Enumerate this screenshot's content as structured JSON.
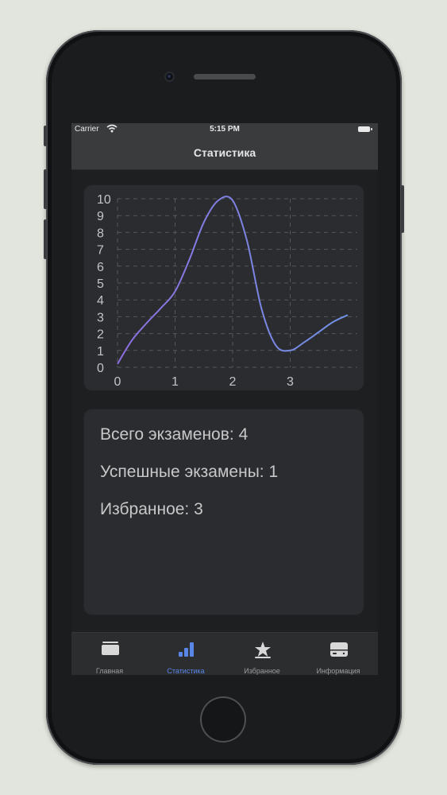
{
  "status_bar": {
    "carrier": "Carrier",
    "time": "5:15 PM"
  },
  "nav": {
    "title": "Статистика"
  },
  "chart_data": {
    "type": "line",
    "x": [
      0,
      0.25,
      0.5,
      0.75,
      1.0,
      1.25,
      1.5,
      1.75,
      2.0,
      2.25,
      2.5,
      2.75,
      3.0,
      3.25,
      3.5,
      3.75,
      4.0
    ],
    "y": [
      0.2,
      1.6,
      2.6,
      3.5,
      4.5,
      6.4,
      8.6,
      9.9,
      9.9,
      7.5,
      3.5,
      1.3,
      1.0,
      1.5,
      2.1,
      2.7,
      3.1
    ],
    "xticks": [
      "0",
      "1",
      "2",
      "3"
    ],
    "yticks": [
      "0",
      "1",
      "2",
      "3",
      "4",
      "5",
      "6",
      "7",
      "8",
      "9",
      "10"
    ],
    "xlim": [
      0,
      4
    ],
    "ylim": [
      0,
      10
    ],
    "grid": true,
    "line_color": "#7b6ee6"
  },
  "stats": {
    "total": "Всего экзаменов: 4",
    "passed": "Успешные экзамены: 1",
    "favorites": "Избранное: 3"
  },
  "tabs": [
    {
      "label": "Главная",
      "icon": "home-cards-icon",
      "active": false
    },
    {
      "label": "Статистика",
      "icon": "bar-chart-icon",
      "active": true
    },
    {
      "label": "Избранное",
      "icon": "star-icon",
      "active": false
    },
    {
      "label": "Информация",
      "icon": "info-card-icon",
      "active": false
    }
  ],
  "colors": {
    "accent": "#5a86e8",
    "background": "#1e1f21",
    "card": "#2b2c2f"
  }
}
